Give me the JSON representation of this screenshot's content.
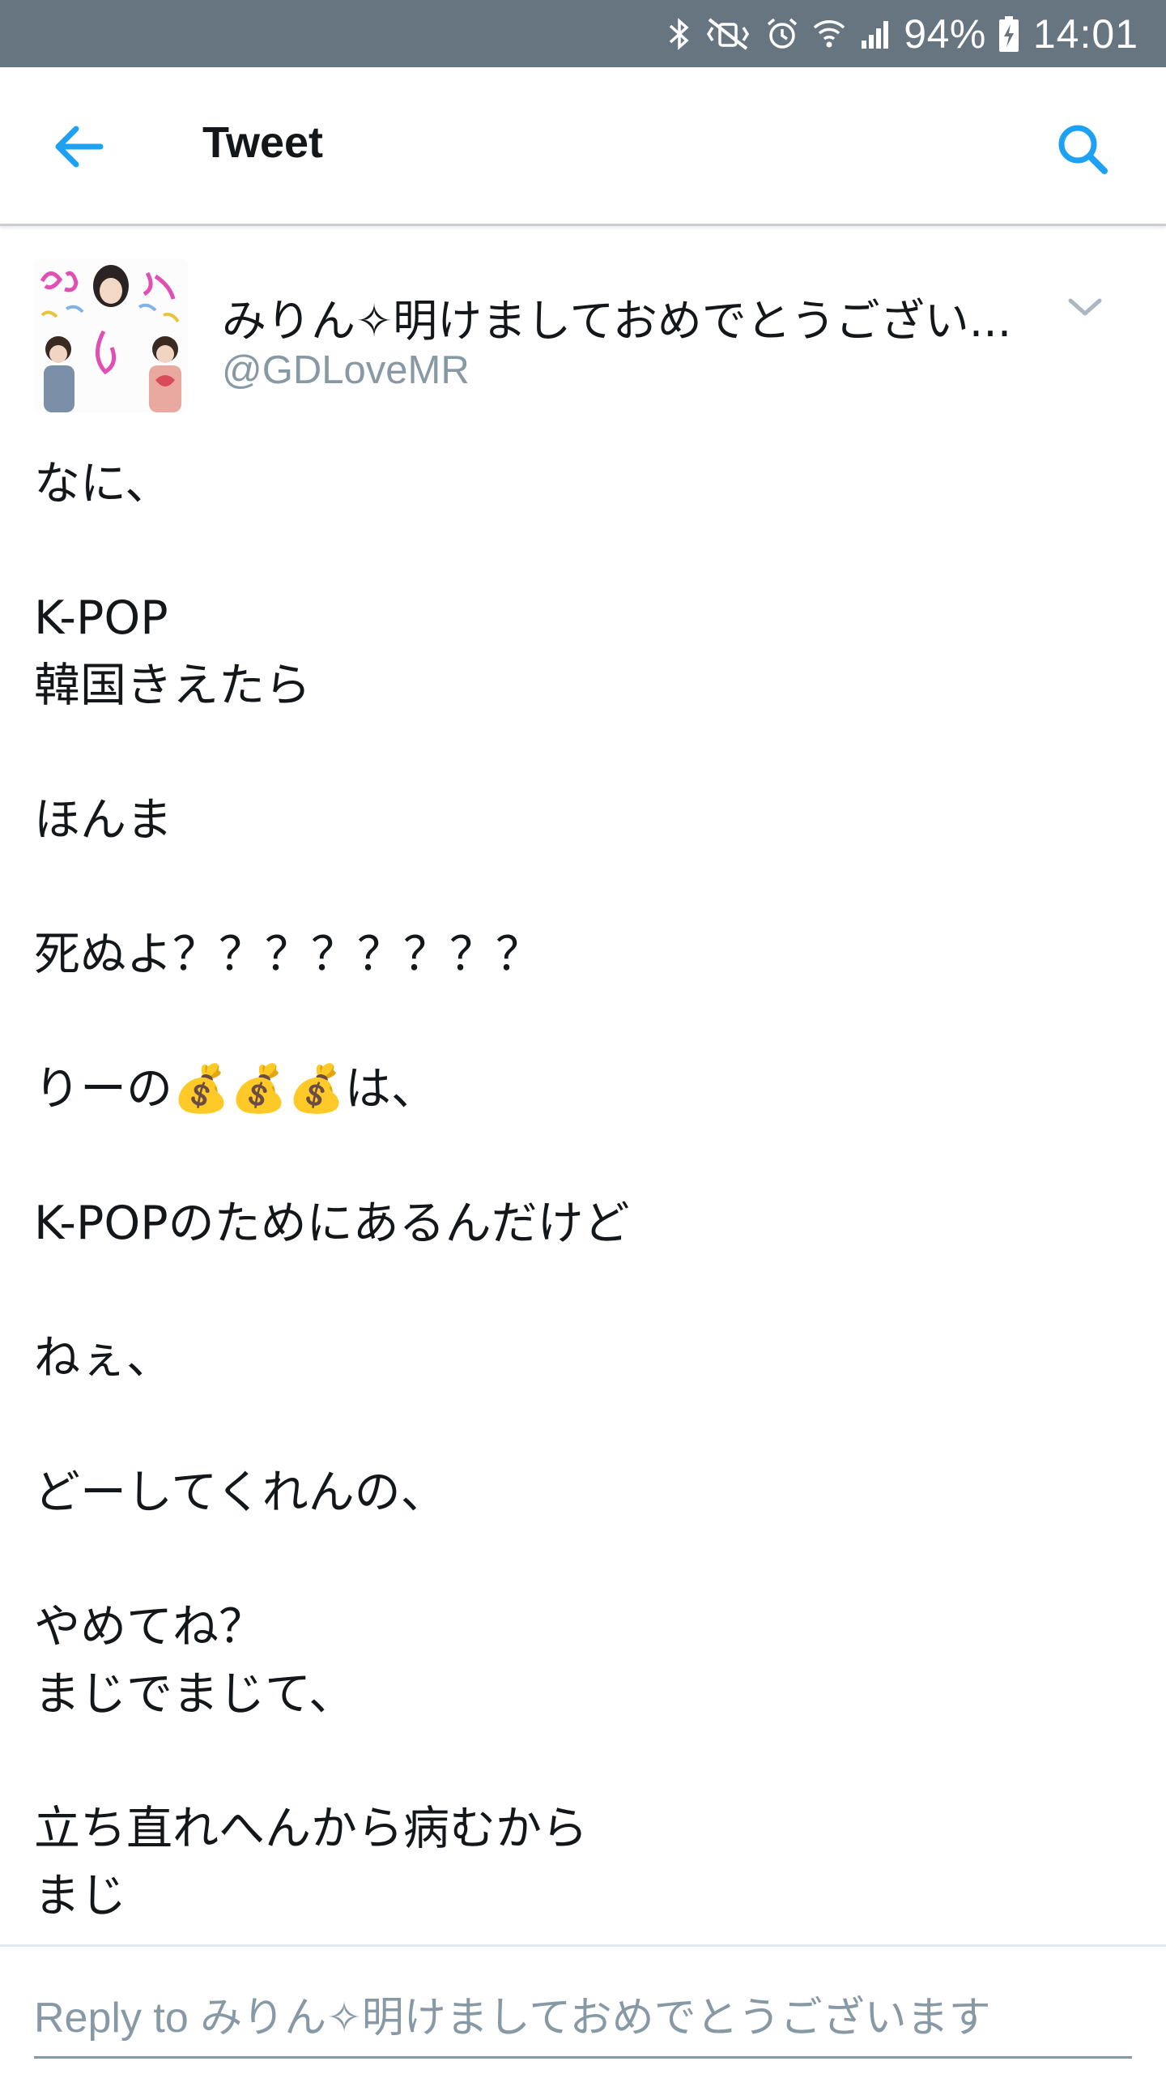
{
  "status_bar": {
    "battery_percent": "94%",
    "time": "14:01",
    "icons": [
      "bluetooth-icon",
      "vibrate-mute-icon",
      "alarm-icon",
      "wifi-icon",
      "signal-icon",
      "battery-charging-icon"
    ]
  },
  "app_bar": {
    "title": "Tweet",
    "back_icon": "back-arrow-icon",
    "search_icon": "search-icon"
  },
  "tweet": {
    "display_name": "みりん✧明けましておめでとうござい...",
    "username": "@GDLoveMR",
    "caret_icon": "chevron-down-icon",
    "body": "なに、\n\nK-POP\n韓国きえたら\n\nほんま\n\n死ぬよ？？？？？？？？\n\nりーの💰💰💰は、\n\nK-POPのためにあるんだけど\n\nねぇ、\n\nどーしてくれんの、\n\nやめてね？\nまじでまじて、\n\n立ち直れへんから病むから\nまじ"
  },
  "reply": {
    "prefix": "Reply to ",
    "name": "みりん✧明けましておめでとうございます"
  },
  "colors": {
    "status_bar": "#66757f",
    "accent": "#1da1f2",
    "text": "#14171a",
    "secondary_text": "#8899a6",
    "divider": "#e1e8ed"
  }
}
